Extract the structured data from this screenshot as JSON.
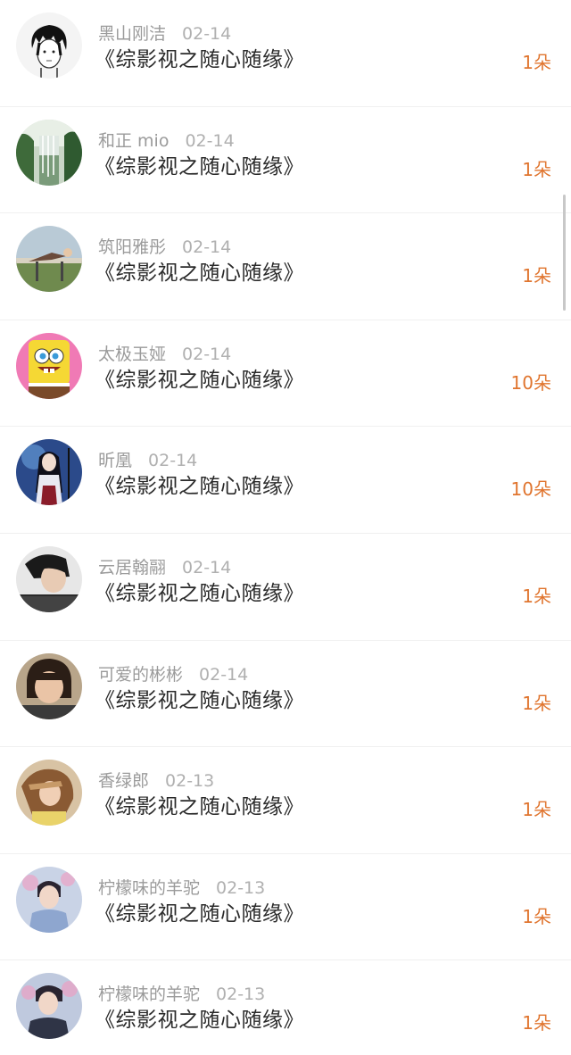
{
  "rows": [
    {
      "name": "黑山刚洁",
      "date": "02-14",
      "title": "《综影视之随心随缘》",
      "count": "1朵",
      "avatar_color": "#f2f2f2"
    },
    {
      "name": "和正 mio",
      "date": "02-14",
      "title": "《综影视之随心随缘》",
      "count": "1朵",
      "avatar_color": "#4f7d4f"
    },
    {
      "name": "筑阳雅彤",
      "date": "02-14",
      "title": "《综影视之随心随缘》",
      "count": "1朵",
      "avatar_color": "#8fa7b8"
    },
    {
      "name": "太极玉娅",
      "date": "02-14",
      "title": "《综影视之随心随缘》",
      "count": "10朵",
      "avatar_color": "#f3d22e"
    },
    {
      "name": "昕凰",
      "date": "02-14",
      "title": "《综影视之随心随缘》",
      "count": "10朵",
      "avatar_color": "#2a3f7a"
    },
    {
      "name": "云居翰翮",
      "date": "02-14",
      "title": "《综影视之随心随缘》",
      "count": "1朵",
      "avatar_color": "#3a3a3a"
    },
    {
      "name": "可爱的彬彬",
      "date": "02-14",
      "title": "《综影视之随心随缘》",
      "count": "1朵",
      "avatar_color": "#6b5040"
    },
    {
      "name": "香绿郎",
      "date": "02-13",
      "title": "《综影视之随心随缘》",
      "count": "1朵",
      "avatar_color": "#c89a6a"
    },
    {
      "name": "柠檬味的羊驼",
      "date": "02-13",
      "title": "《综影视之随心随缘》",
      "count": "1朵",
      "avatar_color": "#a7b7d6"
    },
    {
      "name": "柠檬味的羊驼",
      "date": "02-13",
      "title": "《综影视之随心随缘》",
      "count": "1朵",
      "avatar_color": "#9fb0cc"
    }
  ],
  "colors": {
    "count": "#e0752f",
    "name": "#9b9b9b",
    "title": "#2a2a2a"
  }
}
